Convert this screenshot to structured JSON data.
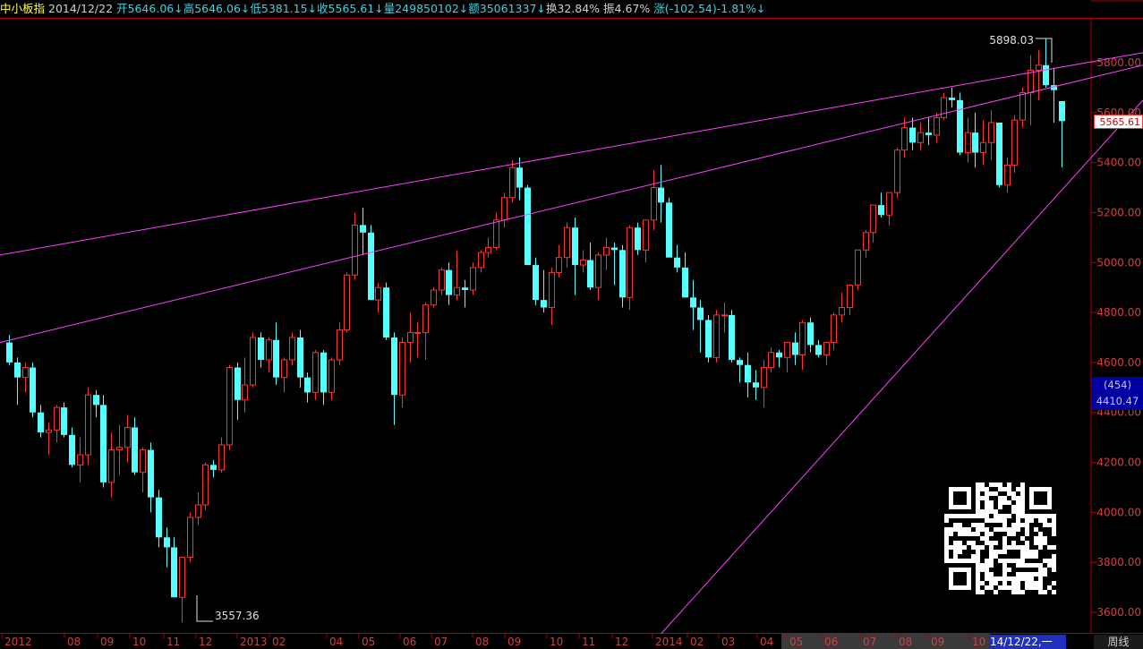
{
  "header": {
    "title": "中小板指",
    "date": "2014/12/22",
    "open": "开5646.06↓",
    "high": "高5646.06↓",
    "low": "低5381.15↓",
    "close": "收5565.61↓",
    "volume": "量249850102↓",
    "amount": "额35061337↓",
    "turnover": "换32.84%",
    "amplitude": "振4.67%",
    "change": "涨(-102.54)-1.81%↓"
  },
  "colors": {
    "up": "#ff3232",
    "down": "#54ffff",
    "trendline": "#ff40ff",
    "axis": "#b00000"
  },
  "chart_data": {
    "type": "candlestick",
    "period": "weekly",
    "ylim": [
      3550,
      5900
    ],
    "y_ticks": [
      "5800.00",
      "5600.00",
      "5400.00",
      "5200.00",
      "5000.00",
      "4800.00",
      "4600.00",
      "4400.00",
      "4200.00",
      "4000.00",
      "3800.00",
      "3600.00"
    ],
    "x_labels": [
      "2012",
      "08",
      "09",
      "10",
      "11",
      "12",
      "2013",
      "02",
      "04",
      "05",
      "06",
      "07",
      "08",
      "09",
      "10",
      "11",
      "12",
      "2014",
      "02",
      "03",
      "04",
      "05",
      "06",
      "07",
      "08",
      "09",
      "10",
      "14/12/22,一"
    ],
    "annotations": {
      "high": "5898.03",
      "low": "3557.36"
    },
    "last_price": "5565.61",
    "volume_label": "(454)",
    "volume_value": "4410.47",
    "period_label": "周线",
    "candles": [
      [
        4680,
        4710,
        4590,
        4600
      ],
      [
        4600,
        4620,
        4430,
        4540
      ],
      [
        4540,
        4600,
        4480,
        4580
      ],
      [
        4580,
        4600,
        4380,
        4400
      ],
      [
        4400,
        4430,
        4300,
        4320
      ],
      [
        4320,
        4360,
        4230,
        4330
      ],
      [
        4330,
        4430,
        4280,
        4420
      ],
      [
        4420,
        4440,
        4300,
        4310
      ],
      [
        4310,
        4340,
        4180,
        4190
      ],
      [
        4190,
        4300,
        4120,
        4230
      ],
      [
        4230,
        4500,
        4190,
        4470
      ],
      [
        4470,
        4490,
        4380,
        4430
      ],
      [
        4430,
        4470,
        4100,
        4120
      ],
      [
        4120,
        4320,
        4060,
        4250
      ],
      [
        4250,
        4350,
        4150,
        4260
      ],
      [
        4260,
        4390,
        4200,
        4340
      ],
      [
        4340,
        4380,
        4150,
        4160
      ],
      [
        4160,
        4260,
        4080,
        4250
      ],
      [
        4250,
        4280,
        4000,
        4060
      ],
      [
        4060,
        4090,
        3860,
        3900
      ],
      [
        3900,
        3940,
        3780,
        3860
      ],
      [
        3860,
        3900,
        3700,
        3660
      ],
      [
        3660,
        3800,
        3560,
        3820
      ],
      [
        3820,
        4000,
        3800,
        3980
      ],
      [
        3980,
        4080,
        3950,
        4030
      ],
      [
        4030,
        4200,
        4010,
        4190
      ],
      [
        4190,
        4210,
        4140,
        4170
      ],
      [
        4170,
        4300,
        4160,
        4270
      ],
      [
        4270,
        4590,
        4250,
        4580
      ],
      [
        4580,
        4600,
        4370,
        4450
      ],
      [
        4450,
        4620,
        4400,
        4510
      ],
      [
        4510,
        4720,
        4500,
        4700
      ],
      [
        4700,
        4720,
        4580,
        4610
      ],
      [
        4610,
        4700,
        4560,
        4690
      ],
      [
        4690,
        4760,
        4510,
        4540
      ],
      [
        4540,
        4620,
        4480,
        4610
      ],
      [
        4610,
        4720,
        4590,
        4700
      ],
      [
        4700,
        4730,
        4500,
        4540
      ],
      [
        4540,
        4560,
        4440,
        4480
      ],
      [
        4480,
        4650,
        4450,
        4640
      ],
      [
        4640,
        4650,
        4430,
        4480
      ],
      [
        4480,
        4620,
        4450,
        4610
      ],
      [
        4610,
        4760,
        4590,
        4730
      ],
      [
        4730,
        4960,
        4720,
        4950
      ],
      [
        4950,
        5200,
        4930,
        5150
      ],
      [
        5150,
        5220,
        5030,
        5120
      ],
      [
        5120,
        5150,
        4870,
        4850
      ],
      [
        4850,
        4920,
        4800,
        4900
      ],
      [
        4900,
        4920,
        4690,
        4700
      ],
      [
        4700,
        4720,
        4350,
        4470
      ],
      [
        4470,
        4700,
        4420,
        4680
      ],
      [
        4680,
        4800,
        4600,
        4720
      ],
      [
        4720,
        4760,
        4620,
        4720
      ],
      [
        4720,
        4840,
        4610,
        4830
      ],
      [
        4830,
        4900,
        4820,
        4890
      ],
      [
        4890,
        4980,
        4870,
        4970
      ],
      [
        4970,
        5000,
        4830,
        4870
      ],
      [
        4870,
        5050,
        4850,
        4900
      ],
      [
        4900,
        4930,
        4820,
        4890
      ],
      [
        4890,
        5000,
        4870,
        4980
      ],
      [
        4980,
        5050,
        4960,
        5040
      ],
      [
        5040,
        5100,
        5020,
        5060
      ],
      [
        5060,
        5200,
        5050,
        5170
      ],
      [
        5170,
        5280,
        5140,
        5260
      ],
      [
        5260,
        5410,
        5240,
        5380
      ],
      [
        5380,
        5420,
        5250,
        5300
      ],
      [
        5300,
        5310,
        5000,
        4990
      ],
      [
        4990,
        5020,
        4830,
        4850
      ],
      [
        4850,
        4970,
        4800,
        4820
      ],
      [
        4820,
        4980,
        4750,
        4960
      ],
      [
        4960,
        5070,
        4940,
        5020
      ],
      [
        5020,
        5160,
        4980,
        5140
      ],
      [
        5140,
        5180,
        4870,
        4990
      ],
      [
        4990,
        5050,
        4960,
        5010
      ],
      [
        5010,
        5080,
        4890,
        4900
      ],
      [
        4900,
        5040,
        4850,
        5030
      ],
      [
        5030,
        5100,
        4970,
        5060
      ],
      [
        5060,
        5080,
        4910,
        5050
      ],
      [
        5050,
        5070,
        4820,
        4860
      ],
      [
        4860,
        5150,
        4810,
        5140
      ],
      [
        5140,
        5160,
        5030,
        5050
      ],
      [
        5050,
        5130,
        5000,
        5170
      ],
      [
        5170,
        5370,
        5130,
        5300
      ],
      [
        5300,
        5390,
        5160,
        5240
      ],
      [
        5240,
        5260,
        5040,
        5020
      ],
      [
        5020,
        5070,
        4960,
        4980
      ],
      [
        4980,
        5040,
        4880,
        4860
      ],
      [
        4860,
        4930,
        4730,
        4820
      ],
      [
        4820,
        4850,
        4640,
        4770
      ],
      [
        4770,
        4790,
        4600,
        4620
      ],
      [
        4620,
        4810,
        4600,
        4790
      ],
      [
        4790,
        4840,
        4720,
        4790
      ],
      [
        4790,
        4810,
        4600,
        4610
      ],
      [
        4610,
        4620,
        4520,
        4590
      ],
      [
        4590,
        4640,
        4460,
        4520
      ],
      [
        4520,
        4570,
        4450,
        4500
      ],
      [
        4500,
        4610,
        4420,
        4580
      ],
      [
        4580,
        4660,
        4560,
        4640
      ],
      [
        4640,
        4650,
        4580,
        4620
      ],
      [
        4620,
        4680,
        4560,
        4680
      ],
      [
        4680,
        4720,
        4590,
        4630
      ],
      [
        4630,
        4770,
        4570,
        4760
      ],
      [
        4760,
        4780,
        4640,
        4670
      ],
      [
        4670,
        4690,
        4620,
        4630
      ],
      [
        4630,
        4660,
        4590,
        4680
      ],
      [
        4680,
        4800,
        4650,
        4790
      ],
      [
        4790,
        4880,
        4760,
        4820
      ],
      [
        4820,
        4900,
        4790,
        4910
      ],
      [
        4910,
        5040,
        4890,
        5050
      ],
      [
        5050,
        5130,
        5020,
        5120
      ],
      [
        5120,
        5230,
        5080,
        5230
      ],
      [
        5230,
        5280,
        5180,
        5190
      ],
      [
        5190,
        5230,
        5150,
        5280
      ],
      [
        5280,
        5460,
        5260,
        5450
      ],
      [
        5450,
        5580,
        5420,
        5540
      ],
      [
        5540,
        5580,
        5450,
        5480
      ],
      [
        5480,
        5560,
        5450,
        5520
      ],
      [
        5520,
        5580,
        5470,
        5510
      ],
      [
        5510,
        5600,
        5480,
        5580
      ],
      [
        5580,
        5680,
        5570,
        5660
      ],
      [
        5660,
        5700,
        5620,
        5650
      ],
      [
        5650,
        5680,
        5430,
        5440
      ],
      [
        5440,
        5580,
        5400,
        5520
      ],
      [
        5520,
        5600,
        5380,
        5440
      ],
      [
        5440,
        5570,
        5390,
        5480
      ],
      [
        5480,
        5610,
        5410,
        5560
      ],
      [
        5560,
        5560,
        5300,
        5310
      ],
      [
        5310,
        5420,
        5280,
        5390
      ],
      [
        5390,
        5590,
        5360,
        5570
      ],
      [
        5570,
        5700,
        5540,
        5680
      ],
      [
        5680,
        5830,
        5550,
        5770
      ],
      [
        5770,
        5850,
        5650,
        5790
      ],
      [
        5790,
        5898,
        5700,
        5710
      ],
      [
        5710,
        5780,
        5560,
        5690
      ],
      [
        5646,
        5646,
        5381,
        5566
      ]
    ],
    "trendlines": [
      {
        "from": [
          0,
          5030
        ],
        "to": [
          1277,
          5840
        ]
      },
      {
        "from": [
          0,
          4680
        ],
        "to": [
          1277,
          5790
        ]
      },
      {
        "from": [
          730,
          3480
        ],
        "to": [
          1277,
          5650
        ]
      }
    ]
  }
}
